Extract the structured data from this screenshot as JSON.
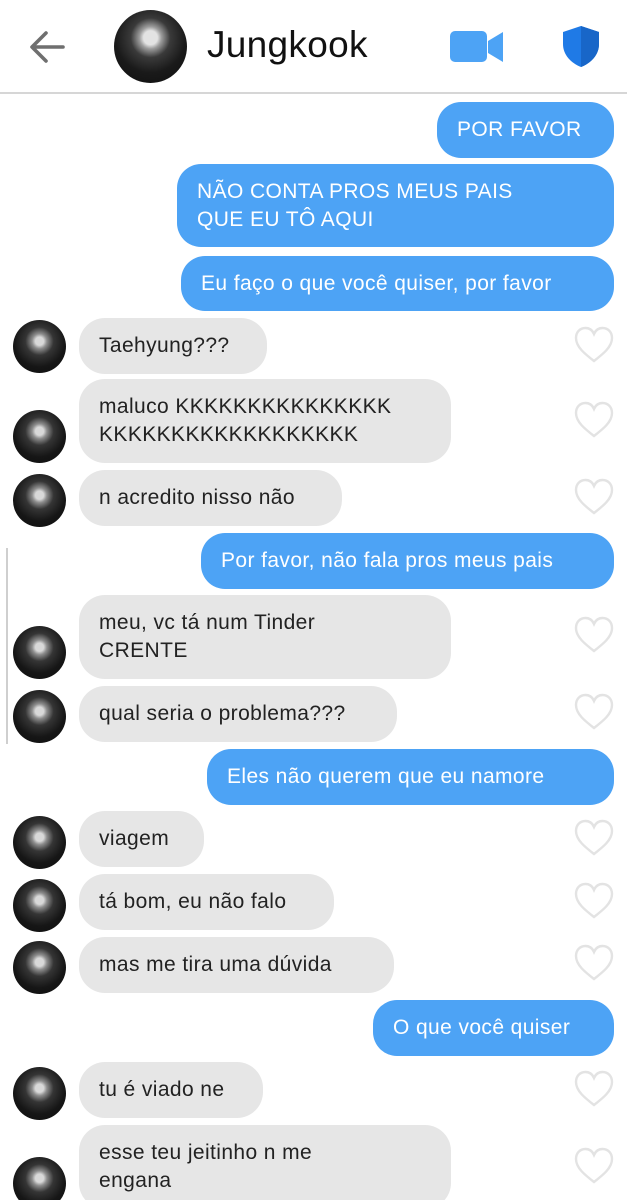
{
  "header": {
    "contact_name": "Jungkook",
    "back_icon": "arrow-left-icon",
    "video_icon": "video-camera-icon",
    "shield_icon": "shield-icon",
    "accent_color": "#4da3f5"
  },
  "messages": [
    {
      "dir": "out",
      "text": "POR FAVOR"
    },
    {
      "dir": "out",
      "text": "NÃO CONTA PROS MEUS PAIS\nQUE EU TÔ AQUI"
    },
    {
      "dir": "out",
      "text": "Eu faço o que você quiser, por favor"
    },
    {
      "dir": "in",
      "text": "Taehyung???"
    },
    {
      "dir": "in",
      "text": "maluco KKKKKKKKKKKKKKK\nKKKKKKKKKKKKKKKKKK"
    },
    {
      "dir": "in",
      "text": "n acredito nisso não"
    },
    {
      "dir": "out",
      "text": "Por favor, não fala pros meus pais"
    },
    {
      "dir": "in",
      "text": "meu, vc tá num Tinder\nCRENTE"
    },
    {
      "dir": "in",
      "text": "qual seria o problema???"
    },
    {
      "dir": "out",
      "text": "Eles não querem que eu namore"
    },
    {
      "dir": "in",
      "text": "viagem"
    },
    {
      "dir": "in",
      "text": "tá bom, eu não falo"
    },
    {
      "dir": "in",
      "text": "mas me tira uma dúvida"
    },
    {
      "dir": "out",
      "text": "O que você quiser"
    },
    {
      "dir": "in",
      "text": "tu é viado ne"
    },
    {
      "dir": "in",
      "text": "esse teu jeitinho n me\nengana"
    }
  ]
}
